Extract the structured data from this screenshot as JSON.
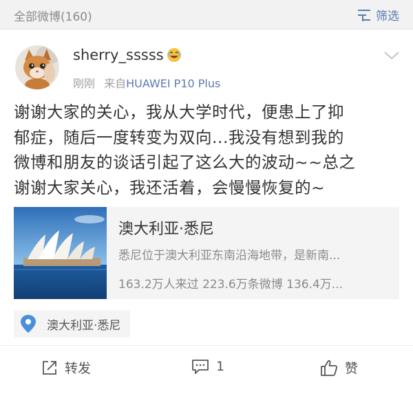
{
  "header": {
    "title": "全部微博(160)",
    "filter_label": "筛选"
  },
  "post": {
    "username": "sherry_sssss",
    "time": "刚刚",
    "source_prefix": "来自",
    "source": "HUAWEI P10 Plus",
    "text_lines": [
      "谢谢大家的关心，我从大学时代，便患上了抑",
      "郁症，随后一度转变为双向...我没有想到我的",
      "微博和朋友的谈话引起了这么大的波动~~总之",
      "谢谢大家关心，我还活着，会慢慢恢复的~"
    ]
  },
  "card": {
    "title": "澳大利亚·悉尼",
    "description": "悉尼位于澳大利亚东南沿海地带，是新南...",
    "stats": "163.2万人来过 223.6万条微博 136.4万..."
  },
  "location": {
    "label": "澳大利亚·悉尼"
  },
  "actions": {
    "repost_label": "转发",
    "comment_count": "1",
    "like_label": "赞"
  },
  "colors": {
    "link": "#5b7bb0",
    "pin": "#4a90d9",
    "muted": "#a0a0a0"
  }
}
